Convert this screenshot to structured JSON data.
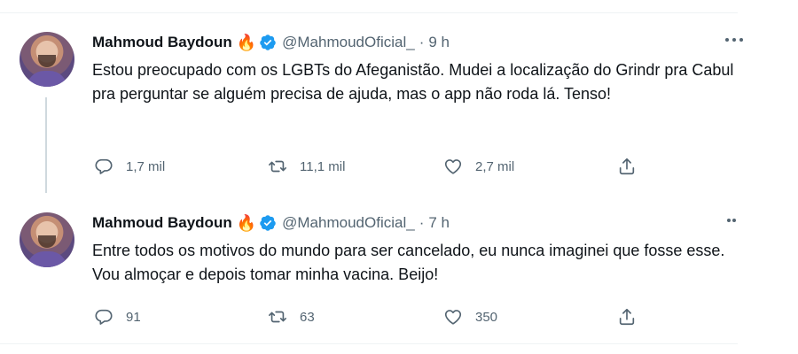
{
  "tweets": [
    {
      "author_name": "Mahmoud Baydoun",
      "handle": "@MahmoudOficial_",
      "separator": "·",
      "time": "9 h",
      "emoji": "🔥",
      "text": "Estou preocupado com os LGBTs do Afeganistão. Mudei a localização do Grindr pra Cabul pra perguntar se alguém precisa de ajuda, mas o app não roda lá. Tenso!",
      "replies": "1,7 mil",
      "retweets": "11,1 mil",
      "likes": "2,7 mil"
    },
    {
      "author_name": "Mahmoud Baydoun",
      "handle": "@MahmoudOficial_",
      "separator": "·",
      "time": "7 h",
      "emoji": "🔥",
      "text": "Entre todos os motivos do mundo para ser cancelado, eu nunca imaginei que fosse esse. Vou almoçar e depois tomar minha vacina. Beijo!",
      "replies": "91",
      "retweets": "63",
      "likes": "350"
    }
  ],
  "icons": {
    "reply": "reply-icon",
    "retweet": "retweet-icon",
    "like": "heart-icon",
    "share": "share-icon",
    "more": "more-icon",
    "verified": "verified-badge-icon"
  },
  "colors": {
    "verified": "#1d9bf0",
    "secondary_text": "#536471",
    "thread_line": "#cfd9de"
  }
}
